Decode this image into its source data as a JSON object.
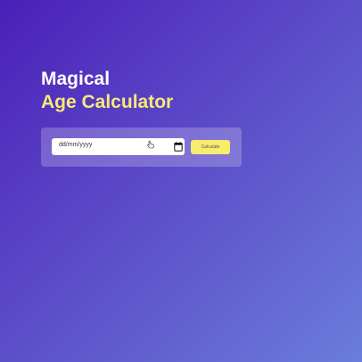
{
  "title": {
    "line1": "Magical",
    "line2": "Age Calculator"
  },
  "form": {
    "date_placeholder": "dd/mm/yyyy",
    "button_label": "Calculate"
  },
  "colors": {
    "gradient_start": "#4a20b8",
    "gradient_end": "#6a7ddb",
    "title_primary": "#ffffff",
    "title_accent": "#f6e97a",
    "button_bg": "#f8ec6e"
  },
  "icons": [
    "cursor-icon",
    "calendar-icon"
  ]
}
